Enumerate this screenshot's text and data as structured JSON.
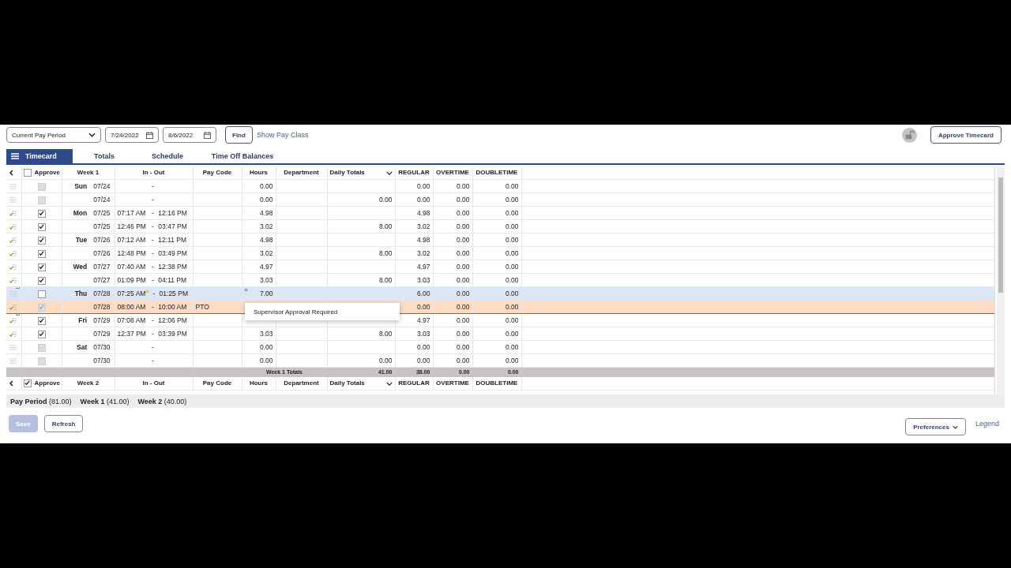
{
  "filters": {
    "period": "Current Pay Period",
    "start_date": "7/24/2022",
    "end_date": "8/6/2022",
    "find": "Find",
    "show_pay_class": "Show Pay Class",
    "approve_timecard": "Approve Timecard"
  },
  "tabs": [
    {
      "label": "Timecard",
      "selected": true
    },
    {
      "label": "Totals",
      "selected": false
    },
    {
      "label": "Schedule",
      "selected": false
    },
    {
      "label": "Time Off Balances",
      "selected": false
    }
  ],
  "week1": {
    "header": {
      "approve": "Approve",
      "approve_all": false,
      "week": "Week 1",
      "in_out": "In - Out",
      "pay_code": "Pay Code",
      "hours": "Hours",
      "department": "Department",
      "daily_totals": "Daily Totals",
      "regular": "REGULAR",
      "overtime": "OVERTIME",
      "doubletime": "DOUBLETIME"
    },
    "rows": [
      {
        "kind": "punch",
        "selected": false,
        "approved": false,
        "checked": false,
        "disabled": true,
        "note": false,
        "flag": false,
        "day": "Sun",
        "date": "07/24",
        "in": "",
        "sep": "-",
        "out": "",
        "hours": "0.00",
        "regular": "0.00",
        "overtime": "0.00",
        "doubletime": "0.00"
      },
      {
        "kind": "punch",
        "selected": false,
        "approved": false,
        "checked": false,
        "disabled": true,
        "note": false,
        "flag": false,
        "date": "07/24",
        "sep": "-",
        "hours": "0.00",
        "daily_total": "0.00",
        "regular": "0.00",
        "overtime": "0.00",
        "doubletime": "0.00"
      },
      {
        "kind": "punch",
        "selected": false,
        "approved": true,
        "checked": true,
        "disabled": false,
        "note": false,
        "flag": false,
        "day": "Mon",
        "date": "07/25",
        "in": "07:17 AM",
        "sep": "-",
        "out": "12:16 PM",
        "hours": "4.98",
        "regular": "4.98",
        "overtime": "0.00",
        "doubletime": "0.00"
      },
      {
        "kind": "punch",
        "selected": false,
        "approved": true,
        "checked": true,
        "disabled": false,
        "note": false,
        "flag": false,
        "date": "07/25",
        "in": "12:46 PM",
        "sep": "-",
        "out": "03:47 PM",
        "hours": "3.02",
        "daily_total": "8.00",
        "regular": "3.02",
        "overtime": "0.00",
        "doubletime": "0.00"
      },
      {
        "kind": "punch",
        "selected": false,
        "approved": true,
        "checked": true,
        "disabled": false,
        "note": false,
        "flag": false,
        "day": "Tue",
        "date": "07/26",
        "in": "07:12 AM",
        "sep": "-",
        "out": "12:11 PM",
        "hours": "4.98",
        "regular": "4.98",
        "overtime": "0.00",
        "doubletime": "0.00"
      },
      {
        "kind": "punch",
        "selected": false,
        "approved": true,
        "checked": true,
        "disabled": false,
        "note": false,
        "flag": false,
        "date": "07/26",
        "in": "12:48 PM",
        "sep": "-",
        "out": "03:49 PM",
        "hours": "3.02",
        "daily_total": "8.00",
        "regular": "3.02",
        "overtime": "0.00",
        "doubletime": "0.00"
      },
      {
        "kind": "punch",
        "selected": false,
        "approved": true,
        "checked": true,
        "disabled": false,
        "note": false,
        "flag": false,
        "day": "Wed",
        "date": "07/27",
        "in": "07:40 AM",
        "sep": "-",
        "out": "12:38 PM",
        "hours": "4.97",
        "regular": "4.97",
        "overtime": "0.00",
        "doubletime": "0.00"
      },
      {
        "kind": "punch",
        "selected": false,
        "approved": true,
        "checked": true,
        "disabled": false,
        "note": false,
        "flag": false,
        "date": "07/27",
        "in": "01:09 PM",
        "sep": "-",
        "out": "04:11 PM",
        "hours": "3.03",
        "daily_total": "8.00",
        "regular": "3.03",
        "overtime": "0.00",
        "doubletime": "0.00"
      },
      {
        "kind": "punch",
        "selected": true,
        "approved": false,
        "checked": false,
        "disabled": false,
        "note": true,
        "flag": true,
        "day": "Thu",
        "date": "07/28",
        "in": "07:25 AM",
        "sep": "-",
        "out": "01:25 PM",
        "hours": "7.00",
        "regular": "6.00",
        "overtime": "0.00",
        "doubletime": "0.00"
      },
      {
        "kind": "pto",
        "selected": false,
        "approved": true,
        "checked": true,
        "disabled": true,
        "note": false,
        "flag": false,
        "date": "07/28",
        "in": "08:00 AM",
        "sep": "-",
        "out": "10:00 AM",
        "pay_code": "PTO",
        "regular": "0.00",
        "overtime": "0.00",
        "doubletime": "0.00"
      },
      {
        "kind": "punch",
        "selected": false,
        "approved": true,
        "checked": true,
        "disabled": false,
        "note": true,
        "flag": false,
        "day": "Fri",
        "date": "07/29",
        "in": "07:08 AM",
        "sep": "-",
        "out": "12:06 PM",
        "regular": "4.97",
        "overtime": "0.00",
        "doubletime": "0.00"
      },
      {
        "kind": "punch",
        "selected": false,
        "approved": true,
        "checked": true,
        "disabled": false,
        "note": false,
        "flag": false,
        "date": "07/29",
        "in": "12:37 PM",
        "sep": "-",
        "out": "03:39 PM",
        "hours": "3.03",
        "daily_total": "8.00",
        "regular": "3.03",
        "overtime": "0.00",
        "doubletime": "0.00"
      },
      {
        "kind": "punch",
        "selected": false,
        "approved": false,
        "checked": false,
        "disabled": true,
        "note": false,
        "flag": false,
        "day": "Sat",
        "date": "07/30",
        "sep": "-",
        "hours": "0.00",
        "regular": "0.00",
        "overtime": "0.00",
        "doubletime": "0.00"
      },
      {
        "kind": "punch",
        "selected": false,
        "approved": false,
        "checked": false,
        "disabled": true,
        "note": false,
        "flag": false,
        "date": "07/30",
        "sep": "-",
        "hours": "0.00",
        "daily_total": "0.00",
        "regular": "0.00",
        "overtime": "0.00",
        "doubletime": "0.00"
      }
    ],
    "totals": {
      "label": "Week 1 Totals",
      "daily_total": "41.00",
      "regular": "38.00",
      "overtime": "0.00",
      "doubletime": "0.00"
    }
  },
  "week2": {
    "header": {
      "approve": "Approve",
      "approve_all": true,
      "week": "Week 2",
      "in_out": "In - Out",
      "pay_code": "Pay Code",
      "hours": "Hours",
      "department": "Department",
      "daily_totals": "Daily Totals",
      "regular": "REGULAR",
      "overtime": "OVERTIME",
      "doubletime": "DOUBLETIME"
    }
  },
  "tooltip": "Supervisor Approval Required",
  "summary": [
    "**Pay Period** (81.00)",
    "**Week 1** (41.00)",
    "**Week 2** (40.00)"
  ],
  "footer": {
    "save": "Save",
    "save_disabled": true,
    "refresh": "Refresh",
    "preferences": "Preferences",
    "legend": "Legend"
  }
}
